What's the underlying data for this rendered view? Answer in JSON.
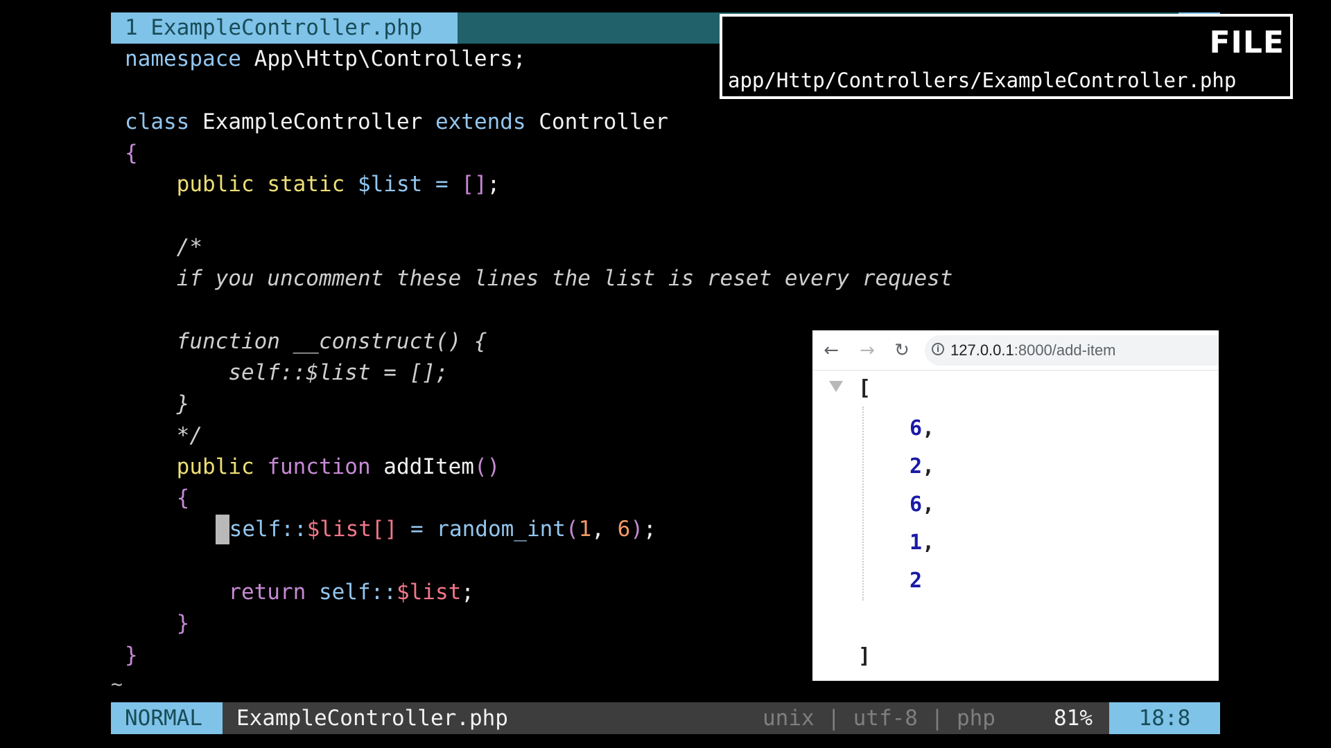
{
  "editor": {
    "tab": {
      "number": "1",
      "filename": "ExampleController.php"
    },
    "code": {
      "namespace_kw": "namespace",
      "namespace_name": "App\\Http\\Controllers;",
      "class_kw": "class",
      "class_name": "ExampleController",
      "extends_kw": "extends",
      "parent_class": "Controller",
      "open_brace": "{",
      "public_kw": "public",
      "static_kw": "static",
      "list_var": "$list",
      "equals": "=",
      "empty_array": "[]",
      "semicolon": ";",
      "comment_open": "/*",
      "comment_text": "if you uncomment these lines the list is reset every request",
      "comment_function": "function __construct() {",
      "comment_body": "self::$list = [];",
      "comment_close_brace": "}",
      "comment_close": "*/",
      "function_kw": "function",
      "method_name": "addItem",
      "parens": "()",
      "self": "self::",
      "list_push": "$list[]",
      "random_fn": "random_int",
      "paren_open": "(",
      "arg1": "1",
      "comma": ",",
      "arg2": "6",
      "paren_close": ")",
      "return_kw": "return",
      "close_brace": "}",
      "tilde": "~"
    },
    "status": {
      "mode": "NORMAL",
      "filename": "ExampleController.php",
      "fileinfo": "unix | utf-8 | php",
      "percent": "81%",
      "position": "18:8"
    }
  },
  "file_overlay": {
    "title": "FILE",
    "path": "app/Http/Controllers/ExampleController.php"
  },
  "browser": {
    "nav": {
      "back": "←",
      "forward": "→",
      "reload": "↻",
      "info": "i"
    },
    "url_host": "127.0.0.1",
    "url_path": ":8000/add-item",
    "json": {
      "open": "[",
      "close": "]",
      "values": [
        "6",
        "2",
        "6",
        "1",
        "2"
      ],
      "comma": ","
    }
  },
  "colors": {
    "background": "#000000",
    "accent": "#7fc3e9",
    "tabline": "#20616a",
    "statusline": "#3d3d3d",
    "json_number": "#1a1aa6"
  }
}
